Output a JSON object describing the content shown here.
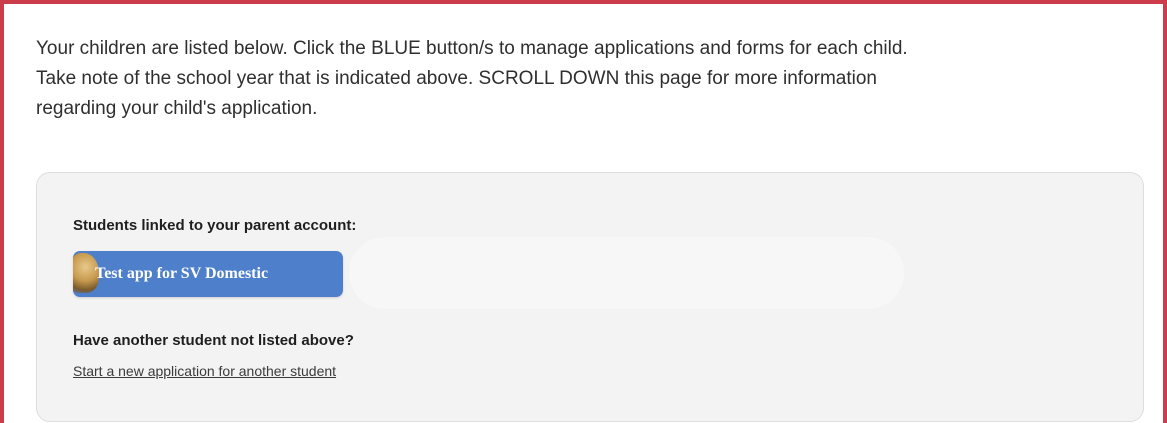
{
  "intro": {
    "line1": "Your children are listed below. Click the BLUE button/s to manage applications and forms for each child.",
    "line2": "Take note of the school year that is indicated above. SCROLL DOWN this page for more information",
    "line3": "regarding your child's application."
  },
  "students_panel": {
    "heading": "Students linked to your parent account:",
    "students": [
      {
        "label": "Test app for SV Domestic"
      }
    ],
    "another_heading": "Have another student not listed above?",
    "new_application_link": "Start a new application for another student"
  },
  "colors": {
    "frame_border": "#cc3d4b",
    "student_button": "#4d7fca",
    "panel_background": "#f3f3f3"
  }
}
